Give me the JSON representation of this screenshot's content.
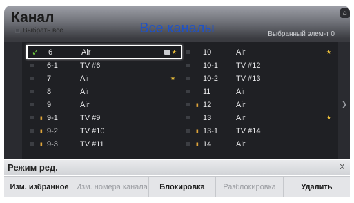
{
  "header": {
    "title": "Канал",
    "select_all_label": "Выбрать все",
    "center_title": "Все каналы",
    "selected_label": "Выбранный элем-т 0"
  },
  "icons": {
    "home": "home-icon",
    "chevron": "chevron-right-icon",
    "lock": "lock-icon",
    "favorite": "star-icon"
  },
  "channels_left": [
    {
      "number": "6",
      "name": "Air",
      "checked": true,
      "locked": false,
      "favorite": true,
      "tag": true,
      "focused": true
    },
    {
      "number": "6-1",
      "name": "TV #6",
      "checked": false,
      "locked": false,
      "favorite": false,
      "tag": false,
      "focused": false
    },
    {
      "number": "7",
      "name": "Air",
      "checked": false,
      "locked": false,
      "favorite": true,
      "tag": false,
      "focused": false
    },
    {
      "number": "8",
      "name": "Air",
      "checked": false,
      "locked": false,
      "favorite": false,
      "tag": false,
      "focused": false
    },
    {
      "number": "9",
      "name": "Air",
      "checked": false,
      "locked": false,
      "favorite": false,
      "tag": false,
      "focused": false
    },
    {
      "number": "9-1",
      "name": "TV #9",
      "checked": false,
      "locked": true,
      "favorite": false,
      "tag": false,
      "focused": false
    },
    {
      "number": "9-2",
      "name": "TV #10",
      "checked": false,
      "locked": true,
      "favorite": false,
      "tag": false,
      "focused": false
    },
    {
      "number": "9-3",
      "name": "TV #11",
      "checked": false,
      "locked": true,
      "favorite": false,
      "tag": false,
      "focused": false
    }
  ],
  "channels_right": [
    {
      "number": "10",
      "name": "Air",
      "checked": false,
      "locked": false,
      "favorite": true,
      "tag": false,
      "focused": false
    },
    {
      "number": "10-1",
      "name": "TV #12",
      "checked": false,
      "locked": false,
      "favorite": false,
      "tag": false,
      "focused": false
    },
    {
      "number": "10-2",
      "name": "TV #13",
      "checked": false,
      "locked": false,
      "favorite": false,
      "tag": false,
      "focused": false
    },
    {
      "number": "11",
      "name": "Air",
      "checked": false,
      "locked": false,
      "favorite": false,
      "tag": false,
      "focused": false
    },
    {
      "number": "12",
      "name": "Air",
      "checked": false,
      "locked": true,
      "favorite": false,
      "tag": false,
      "focused": false
    },
    {
      "number": "13",
      "name": "Air",
      "checked": false,
      "locked": false,
      "favorite": true,
      "tag": false,
      "focused": false
    },
    {
      "number": "13-1",
      "name": "TV #14",
      "checked": false,
      "locked": true,
      "favorite": false,
      "tag": false,
      "focused": false
    },
    {
      "number": "14",
      "name": "Air",
      "checked": false,
      "locked": true,
      "favorite": false,
      "tag": false,
      "focused": false
    }
  ],
  "edit_mode": {
    "title": "Режим ред.",
    "close_label": "X",
    "actions": [
      {
        "label": "Изм. избранное",
        "enabled": true
      },
      {
        "label": "Изм. номера канала",
        "enabled": false
      },
      {
        "label": "Блокировка",
        "enabled": true
      },
      {
        "label": "Разблокировка",
        "enabled": false
      },
      {
        "label": "Удалить",
        "enabled": true
      }
    ]
  },
  "colors": {
    "accent": "#1f52c6",
    "check": "#6ecb3e",
    "star": "#f3c53c",
    "lock": "#e0a53a"
  }
}
